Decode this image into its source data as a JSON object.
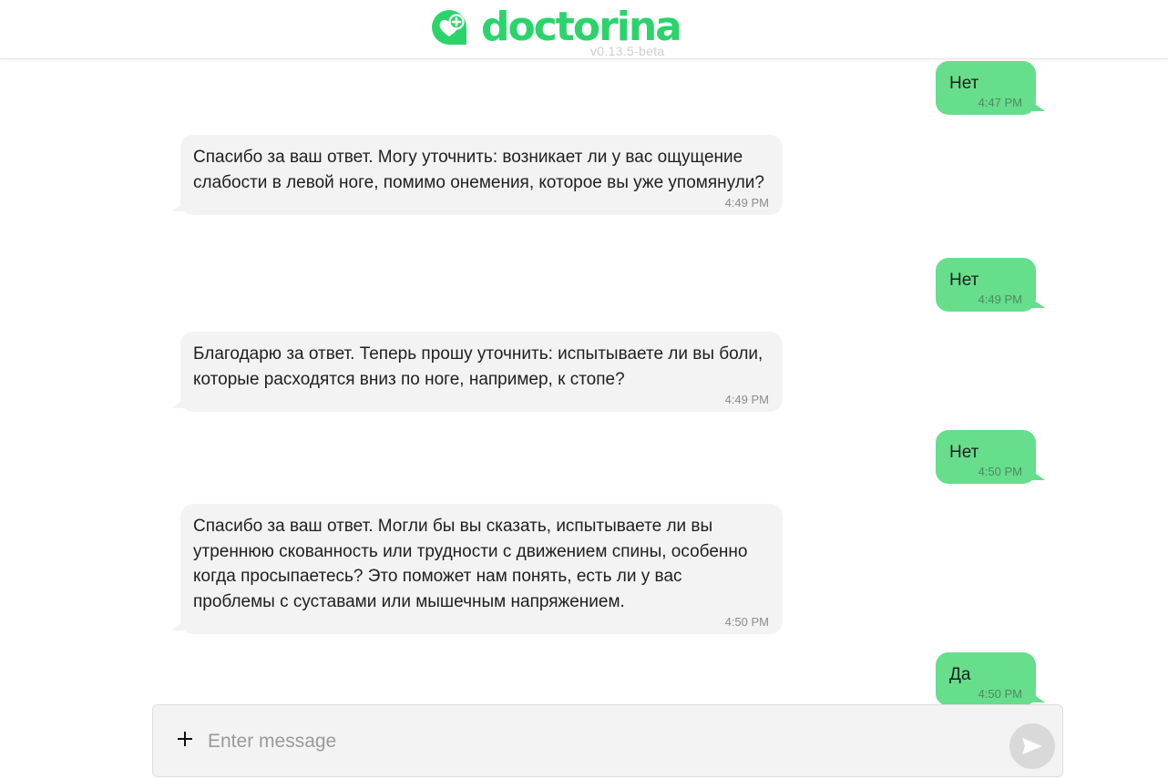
{
  "header": {
    "logo_text": "doctorina",
    "version": "v0.13.5-beta",
    "brand_color": "#2bd46a"
  },
  "messages": [
    {
      "role": "user",
      "text": "Нет",
      "time": "4:47 PM"
    },
    {
      "role": "bot",
      "text": "Спасибо за ваш ответ. Могу уточнить: возникает ли у вас ощущение слабости в левой ноге, помимо онемения, которое вы уже упомянули?",
      "time": "4:49 PM"
    },
    {
      "role": "user",
      "text": "Нет",
      "time": "4:49 PM"
    },
    {
      "role": "bot",
      "text": "Благодарю за ответ. Теперь прошу уточнить: испытываете ли вы боли, которые расходятся вниз по ноге, например, к стопе?",
      "time": "4:49 PM"
    },
    {
      "role": "user",
      "text": "Нет",
      "time": "4:50 PM"
    },
    {
      "role": "bot",
      "text": "Спасибо за ваш ответ. Могли бы вы сказать, испытываете ли вы утреннюю скованность или трудности с движением спины, особенно когда просыпаетесь? Это поможет нам понять, есть ли у вас проблемы с суставами или мышечным напряжением.",
      "time": "4:50 PM"
    },
    {
      "role": "user",
      "text": "Да",
      "time": "4:50 PM"
    }
  ],
  "composer": {
    "placeholder": "Enter message",
    "value": "",
    "attach_icon": "plus-icon",
    "send_icon": "send-icon"
  }
}
